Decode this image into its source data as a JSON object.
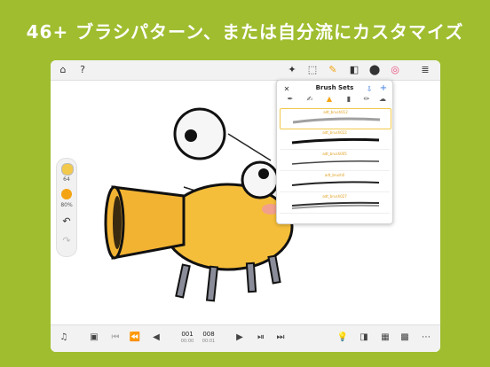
{
  "headline": "46+ ブラシパターン、または自分流にカスタマイズ",
  "topbar": {
    "left_icons": [
      "home-icon",
      "help-icon"
    ],
    "right_icons": [
      "shape-icon",
      "transform-icon",
      "brush-icon",
      "eraser-icon",
      "fill-icon",
      "color-wheel-icon",
      "layers-icon"
    ]
  },
  "left_panel": {
    "brush_size": "64",
    "opacity": "80%",
    "undo_icon": "undo-icon",
    "redo_icon": "redo-icon"
  },
  "brush_panel": {
    "title": "Brush Sets",
    "tabs": [
      "pen",
      "ink",
      "marker",
      "fill",
      "pencil",
      "smudge"
    ],
    "brushes": [
      "adt_brush012",
      "adt_brush022",
      "adt_brush005",
      "adt_brush0",
      "adt_brush027"
    ]
  },
  "bottombar": {
    "current_frame": "001",
    "current_sub": "00:00",
    "total_frames": "008",
    "total_sub": "00:01"
  },
  "colors": {
    "background": "#9fbd2f",
    "accent": "#f3a313"
  }
}
